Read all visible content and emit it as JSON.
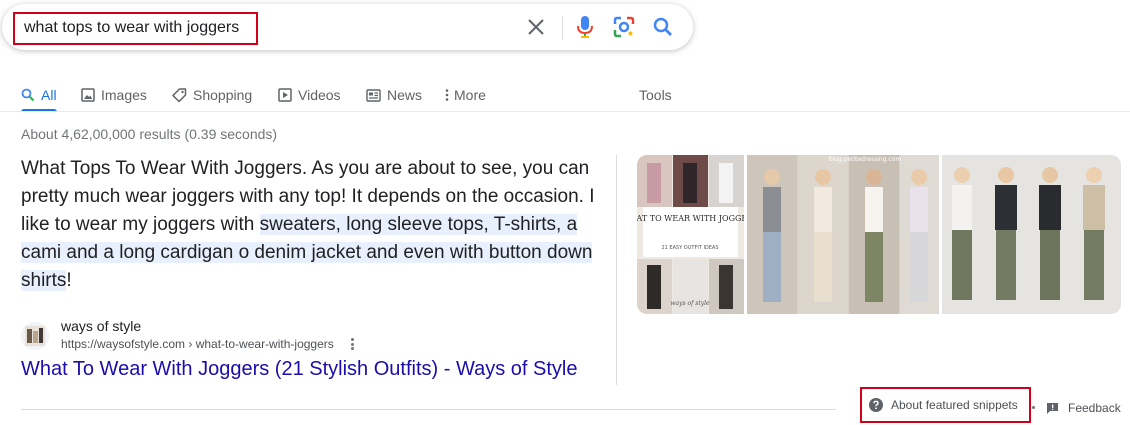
{
  "search": {
    "query": "what tops to wear with joggers",
    "icons": [
      "close-icon",
      "microphone-icon",
      "lens-icon",
      "search-icon"
    ]
  },
  "tabs": [
    {
      "label": "All",
      "icon": "search-icon",
      "active": true
    },
    {
      "label": "Images",
      "icon": "image-icon"
    },
    {
      "label": "Shopping",
      "icon": "tag-icon"
    },
    {
      "label": "Videos",
      "icon": "play-icon"
    },
    {
      "label": "News",
      "icon": "news-icon"
    },
    {
      "label": "More",
      "icon": "vertical-dots-icon"
    }
  ],
  "tools_label": "Tools",
  "result_stats": "About 4,62,00,000 results (0.39 seconds)",
  "snippet": {
    "text_plain": "What Tops To Wear With Joggers. As you are about to see, you can pretty much wear joggers with any top! It depends on the occasion. I like to wear my joggers with ",
    "text_highlight": "sweaters, long sleeve tops, T-shirts, a cami and a long cardigan o denim jacket and even with button down shirts",
    "text_end": "!"
  },
  "source": {
    "site_name": "ways of style",
    "url": "https://waysofstyle.com › what-to-wear-with-joggers"
  },
  "result_title": "What To Wear With Joggers (21 Stylish Outfits) - Ways of Style",
  "images": {
    "collage_title": "WHAT TO WEAR WITH JOGGERS",
    "collage_subtitle": "21 EASY OUTFIT IDEAS",
    "collage_brand": "ways of style",
    "watermark": "blog.petitedressing.com"
  },
  "footer": {
    "about_label": "About featured snippets",
    "feedback_label": "Feedback"
  },
  "colors": {
    "link": "#1a0dab",
    "accent": "#1a73e8",
    "highlight": "#e8f0fe",
    "annotation": "#d0021b"
  }
}
